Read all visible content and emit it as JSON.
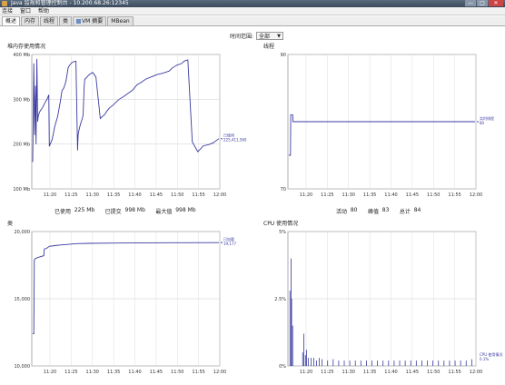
{
  "window": {
    "title": "Java 监视和管理控制台 - 10.200.68.26:12345",
    "buttons": [
      "—",
      "□",
      "✕"
    ]
  },
  "menu": [
    "连接",
    "窗口",
    "帮助"
  ],
  "tabs": [
    "概述",
    "内存",
    "线程",
    "类",
    "VM 摘要",
    "MBean"
  ],
  "time_range": {
    "label": "时间范围:",
    "value": "全部"
  },
  "panels": [
    {
      "title": "堆内存使用情况",
      "stats": [
        {
          "label": "已使用",
          "value": "225",
          "unit": "Mb"
        },
        {
          "label": "已提交",
          "value": "998",
          "unit": "Mb"
        },
        {
          "label": "最大值",
          "value": "998",
          "unit": "Mb"
        }
      ]
    },
    {
      "title": "线程",
      "stats": [
        {
          "label": "活动",
          "value": "80",
          "unit": ""
        },
        {
          "label": "峰值",
          "value": "83",
          "unit": ""
        },
        {
          "label": "总计",
          "value": "84",
          "unit": ""
        }
      ]
    },
    {
      "title": "类",
      "stats": []
    },
    {
      "title": "CPU 使用情况",
      "stats": []
    }
  ],
  "chart_data": [
    {
      "type": "line",
      "title": "堆内存使用情况",
      "ylim": [
        100,
        400
      ],
      "ytick_labels": [
        "100 Mb",
        "200 Mb",
        "300 Mb",
        "400 Mb"
      ],
      "yticks": [
        100,
        200,
        300,
        400
      ],
      "xlim": [
        11.23,
        12.0
      ],
      "xticks": [
        "11:20",
        "11:25",
        "11:30",
        "11:35",
        "11:40",
        "11:45",
        "11:50",
        "11:55",
        "12:00"
      ],
      "series": [
        {
          "name": "已使用",
          "legend_value": "225,411,560",
          "color": "#3a3aa0",
          "x": [
            0,
            0.2,
            0.35,
            0.5,
            0.6,
            0.75,
            0.9,
            1.0,
            1.2,
            1.4,
            1.8,
            2.2,
            2.6,
            2.9,
            3.0,
            3.5,
            4.0,
            4.5,
            5.0,
            5.3,
            5.6,
            6.0,
            6.4,
            6.6,
            6.8,
            7.0,
            7.4,
            7.8,
            8.1,
            8.2,
            8.3,
            8.4,
            8.6,
            8.9,
            9.1,
            9.3,
            9.4,
            9.6,
            9.8,
            10.2,
            10.8,
            11.4,
            12.2,
            13.0,
            13.4,
            13.8,
            14.4,
            15.0,
            15.6,
            16.4,
            17.2,
            18.0,
            18.8,
            19.6,
            20.4,
            21.4,
            22.4,
            23.4,
            24.6,
            25.2,
            26.0,
            26.9,
            27.3,
            27.5,
            27.7,
            28.0,
            28.8,
            29.8,
            30.8,
            31.8,
            32.6,
            33.6
          ],
          "y": [
            160,
            380,
            220,
            330,
            200,
            390,
            250,
            262,
            270,
            275,
            282,
            292,
            300,
            310,
            195,
            210,
            240,
            262,
            296,
            320,
            325,
            340,
            370,
            375,
            378,
            381,
            384,
            385,
            186,
            220,
            228,
            234,
            244,
            255,
            264,
            330,
            345,
            347,
            350,
            355,
            360,
            350,
            257,
            266,
            274,
            280,
            286,
            293,
            300,
            306,
            313,
            320,
            332,
            338,
            345,
            350,
            355,
            358,
            363,
            370,
            376,
            380,
            385,
            386,
            387,
            388,
            205,
            183,
            196,
            199,
            203,
            212
          ]
        }
      ]
    },
    {
      "type": "line",
      "title": "线程",
      "ylim": [
        70,
        90
      ],
      "ytick_labels": [
        "70",
        "90"
      ],
      "yticks": [
        70,
        90
      ],
      "xticks": [
        "11:20",
        "11:25",
        "11:30",
        "11:35",
        "11:40",
        "11:45",
        "11:50",
        "11:55",
        "12:00"
      ],
      "series": [
        {
          "name": "实时线程",
          "legend_value": "80",
          "color": "#3a3aa0",
          "x": [
            0,
            0.3,
            0.35,
            0.7,
            0.75,
            1.4,
            1.6,
            33.6
          ],
          "y": [
            75,
            75,
            81,
            81,
            80,
            80,
            80,
            80
          ]
        }
      ]
    },
    {
      "type": "line",
      "title": "类",
      "ylim": [
        10000,
        20000
      ],
      "ytick_labels": [
        "10,000",
        "15,000",
        "20,000"
      ],
      "yticks": [
        10000,
        15000,
        20000
      ],
      "xticks": [
        "11:20",
        "11:25",
        "11:30",
        "11:35",
        "11:40",
        "11:45",
        "11:50",
        "11:55",
        "12:00"
      ],
      "series": [
        {
          "name": "已加载",
          "legend_value": "19,177",
          "color": "#3a3aa0",
          "x": [
            0,
            0.2,
            0.3,
            0.5,
            0.8,
            1.2,
            2.0,
            2.1,
            2.5,
            3.0,
            4.0,
            5.0,
            6.5,
            8.0,
            10.0,
            15.0,
            20.0,
            25.0,
            33.6
          ],
          "y": [
            12400,
            12400,
            17900,
            18000,
            18050,
            18100,
            18200,
            18700,
            18750,
            18900,
            18950,
            19000,
            19050,
            19100,
            19120,
            19140,
            19160,
            19170,
            19177
          ]
        }
      ]
    },
    {
      "type": "bar",
      "title": "CPU 使用情况",
      "ylim": [
        0,
        5
      ],
      "ytick_labels": [
        "0%",
        "2.5%",
        "5%"
      ],
      "yticks": [
        0,
        2.5,
        5
      ],
      "xticks": [
        "11:20",
        "11:25",
        "11:30",
        "11:35",
        "11:40",
        "11:45",
        "11:50",
        "11:55",
        "12:00"
      ],
      "series": [
        {
          "name": "CPU 使用情况",
          "legend_value": "0.1%",
          "color": "#3a3aa0",
          "x": [
            0.2,
            0.4,
            0.5,
            0.7,
            2.5,
            2.7,
            3.0,
            3.2,
            3.5,
            4.0,
            4.5,
            5.0,
            5.5,
            6.0,
            7.0,
            8.0,
            9.0,
            10.0,
            11.0,
            12.0,
            13.0,
            14.0,
            15.0,
            16.0,
            17.0,
            18.0,
            19.0,
            20.0,
            21.0,
            22.0,
            23.0,
            24.0,
            25.0,
            26.0,
            27.0,
            28.0,
            29.0,
            30.0,
            31.0,
            32.0,
            33.0
          ],
          "y": [
            2.8,
            4.0,
            2.5,
            1.5,
            0.5,
            1.2,
            0.4,
            0.6,
            0.3,
            0.3,
            0.3,
            0.2,
            0.3,
            0.25,
            0.2,
            0.25,
            0.2,
            0.2,
            0.2,
            0.2,
            0.2,
            0.2,
            0.2,
            0.2,
            0.2,
            0.2,
            0.2,
            0.2,
            0.2,
            0.2,
            0.2,
            0.2,
            0.2,
            0.2,
            0.2,
            0.2,
            0.2,
            0.2,
            0.2,
            0.2,
            0.25
          ]
        }
      ]
    }
  ]
}
